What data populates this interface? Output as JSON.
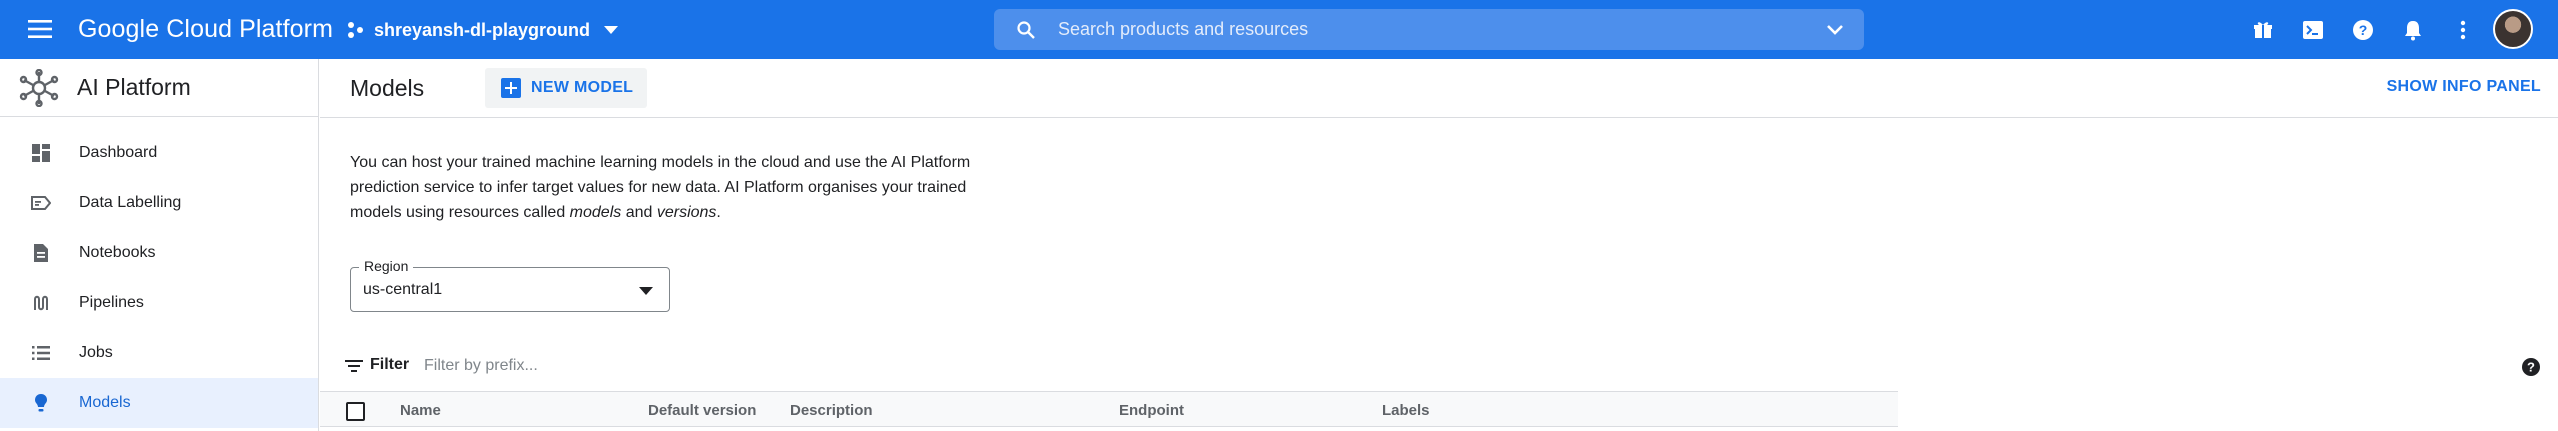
{
  "topbar": {
    "brand": "Google Cloud Platform",
    "project": "shreyansh-dl-playground",
    "search_placeholder": "Search products and resources",
    "icons": [
      "gift-icon",
      "cloud-shell-icon",
      "help-icon",
      "notifications-icon",
      "more-vert-icon"
    ]
  },
  "sidebar": {
    "title": "AI Platform",
    "items": [
      {
        "label": "Dashboard",
        "icon": "dashboard-icon"
      },
      {
        "label": "Data Labelling",
        "icon": "data-labelling-icon"
      },
      {
        "label": "Notebooks",
        "icon": "notebooks-icon"
      },
      {
        "label": "Pipelines",
        "icon": "pipelines-icon"
      },
      {
        "label": "Jobs",
        "icon": "jobs-icon"
      },
      {
        "label": "Models",
        "icon": "models-icon",
        "active": true
      }
    ]
  },
  "main": {
    "title": "Models",
    "new_model_label": "NEW MODEL",
    "info_panel_label": "SHOW INFO PANEL",
    "description": {
      "part1": "You can host your trained machine learning models in the cloud and use the AI Platform prediction service to infer target values for new data. AI Platform organises your trained models using resources called ",
      "em1": "models",
      "part2": " and ",
      "em2": "versions",
      "part3": "."
    },
    "region": {
      "label": "Region",
      "value": "us-central1"
    },
    "filter": {
      "label": "Filter",
      "placeholder": "Filter by prefix..."
    },
    "table": {
      "columns": [
        "Name",
        "Default version",
        "Description",
        "Endpoint",
        "Labels"
      ]
    }
  },
  "colors": {
    "topbar": "#1a73e8",
    "accent": "#1a73e8",
    "active_bg": "#e8f0fe"
  }
}
